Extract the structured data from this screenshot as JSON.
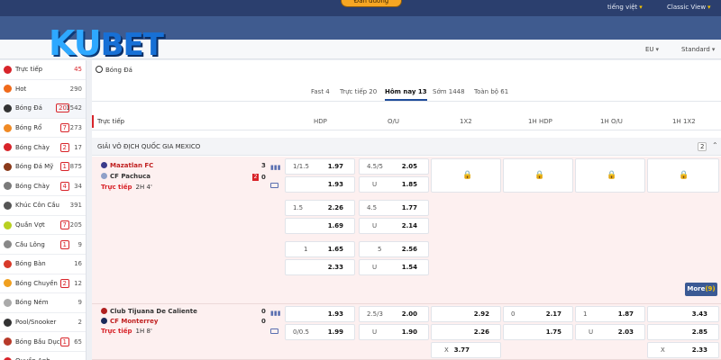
{
  "topbar": {
    "login": "Đăn đường",
    "language": "tiếng việt",
    "view": "Classic View"
  },
  "logo": {
    "ku": "KU",
    "bet": "BET"
  },
  "subheader": {
    "odds_format": "EU",
    "mode": "Standard"
  },
  "sidebar": {
    "items": [
      {
        "label": "Trực tiếp",
        "live": "",
        "count": "45",
        "icon_color": "#d8242a"
      },
      {
        "label": "Hot",
        "live": "",
        "count": "290",
        "icon_color": "#f06a1a"
      },
      {
        "label": "Bóng Đá",
        "live": "20",
        "count": "1542",
        "icon_color": "#333333"
      },
      {
        "label": "Bóng Rổ",
        "live": "7",
        "count": "273",
        "icon_color": "#f08a24"
      },
      {
        "label": "Bóng Chày",
        "live": "2",
        "count": "17",
        "icon_color": "#d8242a"
      },
      {
        "label": "Bóng Đá Mỹ",
        "live": "1",
        "count": "875",
        "icon_color": "#8a3a1a"
      },
      {
        "label": "Bóng Chày",
        "live": "4",
        "count": "34",
        "icon_color": "#7a7a7a"
      },
      {
        "label": "Khúc Côn Cầu",
        "live": "",
        "count": "391",
        "icon_color": "#555555"
      },
      {
        "label": "Quần Vợt",
        "live": "7",
        "count": "205",
        "icon_color": "#b8d020"
      },
      {
        "label": "Cầu Lông",
        "live": "1",
        "count": "9",
        "icon_color": "#888888"
      },
      {
        "label": "Bóng Bàn",
        "live": "",
        "count": "16",
        "icon_color": "#d83a2a"
      },
      {
        "label": "Bóng Chuyền",
        "live": "2",
        "count": "12",
        "icon_color": "#f0a020"
      },
      {
        "label": "Bóng Ném",
        "live": "",
        "count": "9",
        "icon_color": "#aaaaaa"
      },
      {
        "label": "Pool/Snooker",
        "live": "",
        "count": "2",
        "icon_color": "#333333"
      },
      {
        "label": "Bóng Bầu Dục",
        "live": "1",
        "count": "65",
        "icon_color": "#b83a2a"
      },
      {
        "label": "Quyền Anh",
        "live": "",
        "count": "",
        "icon_color": "#d8242a"
      }
    ]
  },
  "main": {
    "title": "Bóng Đá",
    "tabs": [
      "Fast 4",
      "Trực tiếp 20",
      "Hôm nay 13",
      "Sớm 1448",
      "Toàn bộ 61"
    ],
    "active_tab": 2,
    "columns": {
      "live": "Trực tiếp",
      "hdp": "HDP",
      "ou": "O/U",
      "x12": "1X2",
      "h1hdp": "1H HDP",
      "h1ou": "1H O/U",
      "h1x12": "1H 1X2"
    },
    "league": {
      "name": "GIẢI VÔ ĐỊCH QUỐC GIA MEXICO",
      "count": "2"
    },
    "match1": {
      "home": "Mazatlan FC",
      "away": "CF Pachuca",
      "home_score": "3",
      "away_score": "0",
      "red_cards": "2",
      "status": "Trực tiếp",
      "time": "2H 4'",
      "rows": [
        {
          "hdp_line": "1/1.5",
          "hdp_home": "1.97",
          "hdp_away": "1.93",
          "ou_line": "4.5/5",
          "ou_over": "2.05",
          "ou_u": "U",
          "ou_under": "1.85"
        },
        {
          "hdp_line": "1.5",
          "hdp_home": "2.26",
          "hdp_away": "1.69",
          "ou_line": "4.5",
          "ou_over": "1.77",
          "ou_u": "U",
          "ou_under": "2.14"
        },
        {
          "hdp_line": "1",
          "hdp_home": "1.65",
          "hdp_away": "2.33",
          "ou_line": "5",
          "ou_over": "2.56",
          "ou_u": "U",
          "ou_under": "1.54"
        }
      ],
      "more_label": "More",
      "more_count": "(9)"
    },
    "match2": {
      "home": "Club Tijuana De Caliente",
      "away": "CF Monterrey",
      "home_score": "0",
      "away_score": "0",
      "status": "Trực tiếp",
      "time": "1H 8'",
      "hdp_home": "1.93",
      "hdp_away_line": "0/0.5",
      "hdp_away": "1.99",
      "ou_line": "2.5/3",
      "ou_over": "2.00",
      "ou_u": "U",
      "ou_under": "1.90",
      "x12_1": "2.92",
      "x12_2": "2.26",
      "x12_x_lbl": "X",
      "x12_x": "3.77",
      "h1hdp_line": "0",
      "h1hdp_home": "2.17",
      "h1hdp_away": "1.75",
      "h1ou_line": "1",
      "h1ou_over": "1.87",
      "h1ou_u": "U",
      "h1ou_under": "2.03",
      "h1x12_1": "3.43",
      "h1x12_2": "2.85",
      "h1x12_x_lbl": "X",
      "h1x12_x": "2.33"
    }
  },
  "colors": {
    "brand": "#3f5b8f",
    "live_red": "#d8242a",
    "accent": "#f6a623"
  }
}
